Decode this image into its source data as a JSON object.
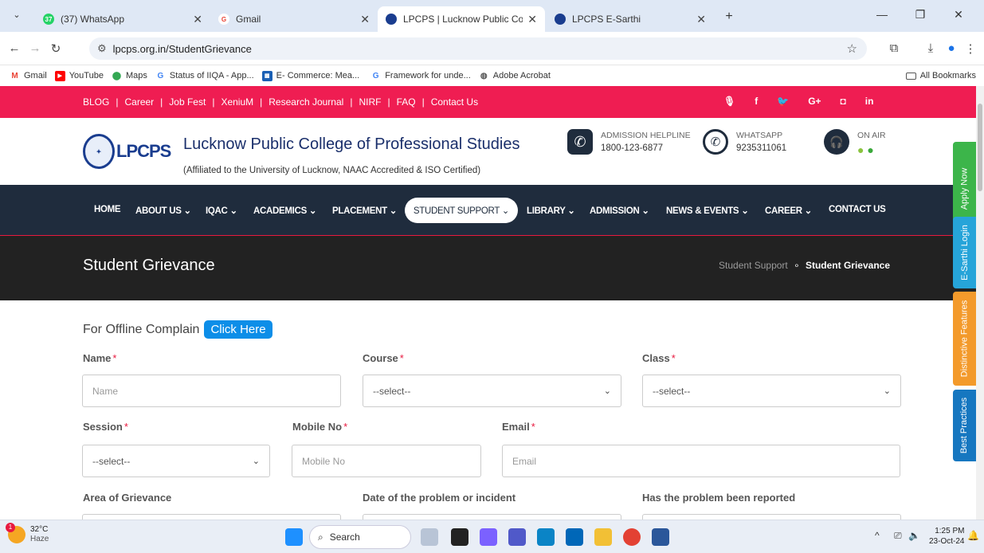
{
  "browser": {
    "tabs": [
      {
        "title": "(37) WhatsApp",
        "badge": "37"
      },
      {
        "title": "Gmail"
      },
      {
        "title": "LPCPS | Lucknow Public College",
        "active": true
      },
      {
        "title": "LPCPS E-Sarthi"
      }
    ],
    "url": "lpcps.org.in/StudentGrievance",
    "bookmarks": [
      "Gmail",
      "YouTube",
      "Maps",
      "Status of IIQA - App...",
      "E- Commerce: Mea...",
      "Framework for unde...",
      "Adobe Acrobat"
    ],
    "all_bookmarks": "All Bookmarks"
  },
  "site": {
    "toplinks": [
      "BLOG",
      "Career",
      "Job Fest",
      "XeniuM",
      "Research Journal",
      "NIRF",
      "FAQ",
      "Contact Us"
    ],
    "social": [
      "🎙",
      "f",
      "🐦",
      "G+",
      "◘",
      "in"
    ],
    "logo_text": "LPCPS",
    "college_name": "Lucknow Public College of Professional Studies",
    "affiliation": "(Affiliated to the University of Lucknow, NAAC Accredited & ISO Certified)",
    "helpline_label": "ADMISSION HELPLINE",
    "helpline_number": "1800-123-6877",
    "whatsapp_label": "WHATSAPP",
    "whatsapp_number": "9235311061",
    "onair_label": "ON AIR",
    "menu": [
      "HOME",
      "ABOUT US ⌄",
      "IQAC ⌄",
      "ACADEMICS ⌄",
      "PLACEMENT ⌄",
      "STUDENT SUPPORT ⌄",
      "LIBRARY ⌄",
      "ADMISSION ⌄",
      "NEWS & EVENTS ⌄",
      "CAREER ⌄",
      "CONTACT US"
    ],
    "page_title": "Student Grievance",
    "breadcrumb_parent": "Student Support",
    "breadcrumb_current": "Student Grievance"
  },
  "form": {
    "offline_text": "For Offline Complain",
    "click_here": "Click Here",
    "name_label": "Name",
    "name_placeholder": "Name",
    "course_label": "Course",
    "course_value": "--select--",
    "class_label": "Class",
    "class_value": "--select--",
    "session_label": "Session",
    "session_value": "--select--",
    "mobile_label": "Mobile No",
    "mobile_placeholder": "Mobile No",
    "email_label": "Email",
    "email_placeholder": "Email",
    "area_label": "Area of Grievance",
    "date_label": "Date of the problem or incident",
    "reported_label": "Has the problem been reported",
    "required_mark": "*"
  },
  "side_tabs": [
    {
      "label": "Apply Now",
      "color": "#3cb54a"
    },
    {
      "label": "E-Sarthi Login",
      "color": "#26a4d9"
    },
    {
      "label": "Distinctive Features",
      "color": "#f39a2b"
    },
    {
      "label": "Best Practices",
      "color": "#1677c0"
    }
  ],
  "taskbar": {
    "weather_temp": "32°C",
    "weather_desc": "Haze",
    "weather_badge": "1",
    "search": "Search",
    "time": "1:25 PM",
    "date": "23-Oct-24"
  },
  "colors": {
    "accent_red": "#ef1d52",
    "nav_dark": "#1f2c3d",
    "link_blue": "#0d8ee8"
  }
}
